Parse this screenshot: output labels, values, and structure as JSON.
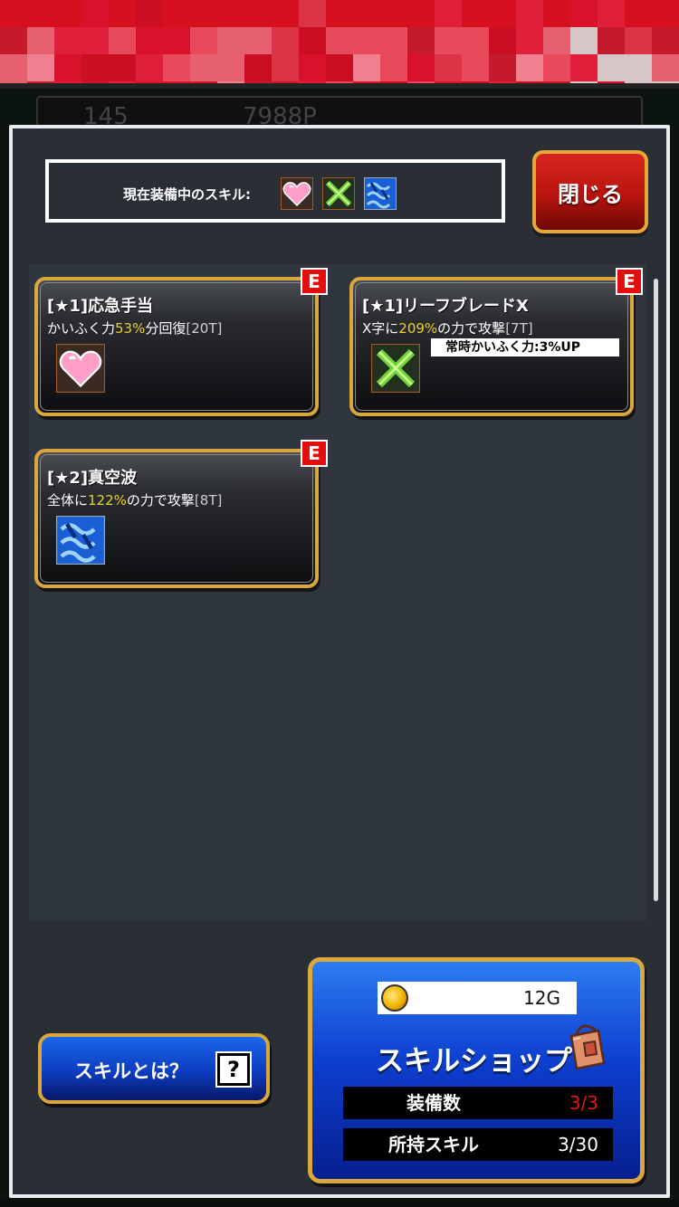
{
  "colors": {
    "panel_bg": "#2a2f36",
    "card_border": "#d9a73b",
    "highlight_yellow": "#e8d22a",
    "badge_red": "#e30d0d",
    "close_red": "#c81a14",
    "shop_blue": "#0d3fd0"
  },
  "background": {
    "stat_left": "145",
    "stat_mid": "7988P"
  },
  "header": {
    "equipped_label": "現在装備中のスキル:",
    "equipped_icons": [
      "heart-icon",
      "leaf-x-icon",
      "wave-icon"
    ],
    "close_label": "閉じる"
  },
  "skills": [
    {
      "name": "[★1]応急手当",
      "desc_pre": "かいふく力",
      "desc_hl": "53%",
      "desc_post": "分回復",
      "desc_turns": "[20T]",
      "icon": "heart-icon",
      "badge": "E"
    },
    {
      "name": "[★1]リーフブレードX",
      "desc_pre": "X字に",
      "desc_hl": "209%",
      "desc_post": "の力で攻撃",
      "desc_turns": "[7T]",
      "icon": "leaf-x-icon",
      "badge": "E",
      "passive": "常時かいふく力:3%UP"
    },
    {
      "name": "[★2]真空波",
      "desc_pre": "全体に",
      "desc_hl": "122%",
      "desc_post": "の力で攻撃",
      "desc_turns": "[8T]",
      "icon": "wave-icon",
      "badge": "E"
    }
  ],
  "about_button": {
    "label": "スキルとは？",
    "icon_glyph": "?"
  },
  "shop": {
    "gold": "12G",
    "title": "スキルショップ",
    "equip_label": "装備数",
    "equip_value": "3/3",
    "owned_label": "所持スキル",
    "owned_value": "3/30"
  }
}
